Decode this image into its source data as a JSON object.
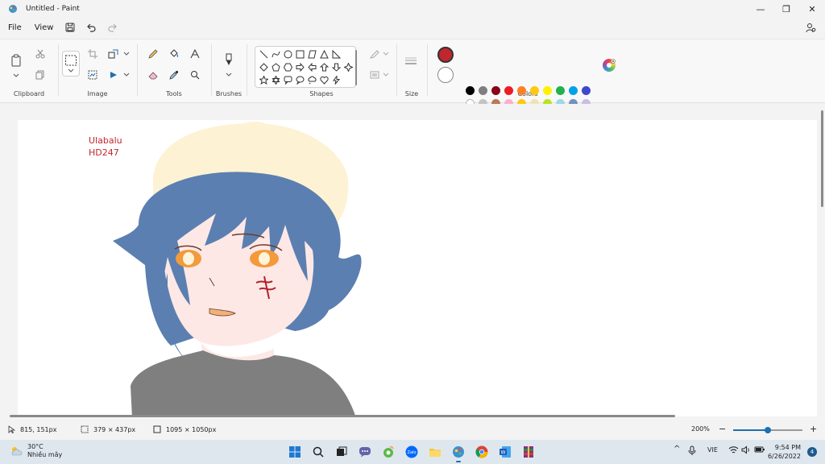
{
  "window": {
    "title": "Untitled - Paint",
    "minimize": "—",
    "maximize": "❐",
    "close": "✕"
  },
  "menu": {
    "file": "File",
    "view": "View"
  },
  "ribbon": {
    "groups": {
      "clipboard": "Clipboard",
      "image": "Image",
      "tools": "Tools",
      "brushes": "Brushes",
      "shapes": "Shapes",
      "size": "Size",
      "colors": "Colors"
    },
    "selected_color": "#c0262d",
    "palette_row1": [
      "#000000",
      "#7f7f7f",
      "#880015",
      "#ed1c24",
      "#ff7f27",
      "#ffc90e",
      "#fff200",
      "#22b14c",
      "#00a2e8",
      "#3f48cc",
      "#a349a4"
    ],
    "palette_row2": [
      "#ffffff",
      "#c3c3c3",
      "#b97a57",
      "#ffaec9",
      "#ffc90e",
      "#efe4b0",
      "#b5e61d",
      "#99d9ea",
      "#7092be",
      "#c8bfe7"
    ],
    "palette_row3": [
      "#5b7fb0",
      "#fdf2d3",
      "#b3202a"
    ]
  },
  "canvas": {
    "signature_line1": "Ulabalu",
    "signature_line2": "HD247"
  },
  "status": {
    "cursor_pos": "815, 151px",
    "selection_size": "379 × 437px",
    "image_size": "1095 × 1050px",
    "zoom": "200%",
    "zoom_level_fraction": 0.5
  },
  "taskbar": {
    "temperature": "30°C",
    "weather_desc": "Nhiều mây",
    "language": "VIE",
    "time": "9:54 PM",
    "date": "6/26/2022",
    "notifications": "4"
  }
}
